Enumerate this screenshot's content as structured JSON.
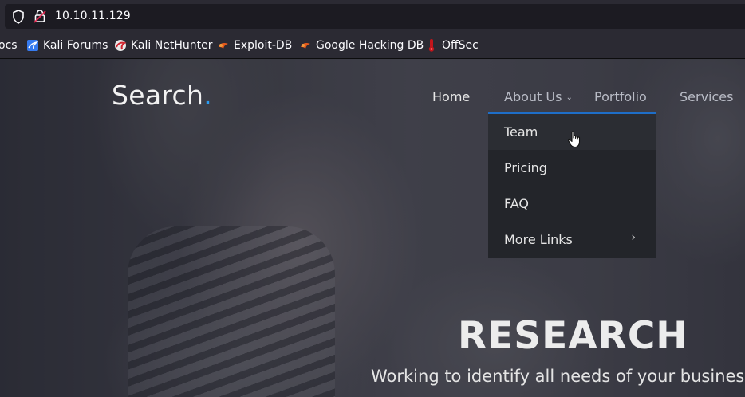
{
  "browser": {
    "url": "10.10.11.129",
    "bookmarks": [
      {
        "label": "ocs",
        "icon": "none"
      },
      {
        "label": "Kali Forums",
        "icon": "kali-forums-icon"
      },
      {
        "label": "Kali NetHunter",
        "icon": "kali-nethunter-icon"
      },
      {
        "label": "Exploit-DB",
        "icon": "exploit-db-icon"
      },
      {
        "label": "Google Hacking DB",
        "icon": "ghdb-icon"
      },
      {
        "label": "OffSec",
        "icon": "offsec-icon"
      }
    ]
  },
  "site": {
    "logo": "Search",
    "logo_dot": ".",
    "nav": {
      "home": "Home",
      "about": "About Us",
      "portfolio": "Portfolio",
      "services": "Services"
    },
    "dropdown": [
      {
        "label": "Team"
      },
      {
        "label": "Pricing"
      },
      {
        "label": "FAQ"
      },
      {
        "label": "More Links"
      }
    ],
    "hero": {
      "title": "RESEARCH",
      "subtitle": "Working to identify all needs of your business."
    }
  },
  "colors": {
    "accent": "#2a9df4",
    "dropdown_bg": "#23252a",
    "dropdown_border": "#1e6ec8"
  }
}
